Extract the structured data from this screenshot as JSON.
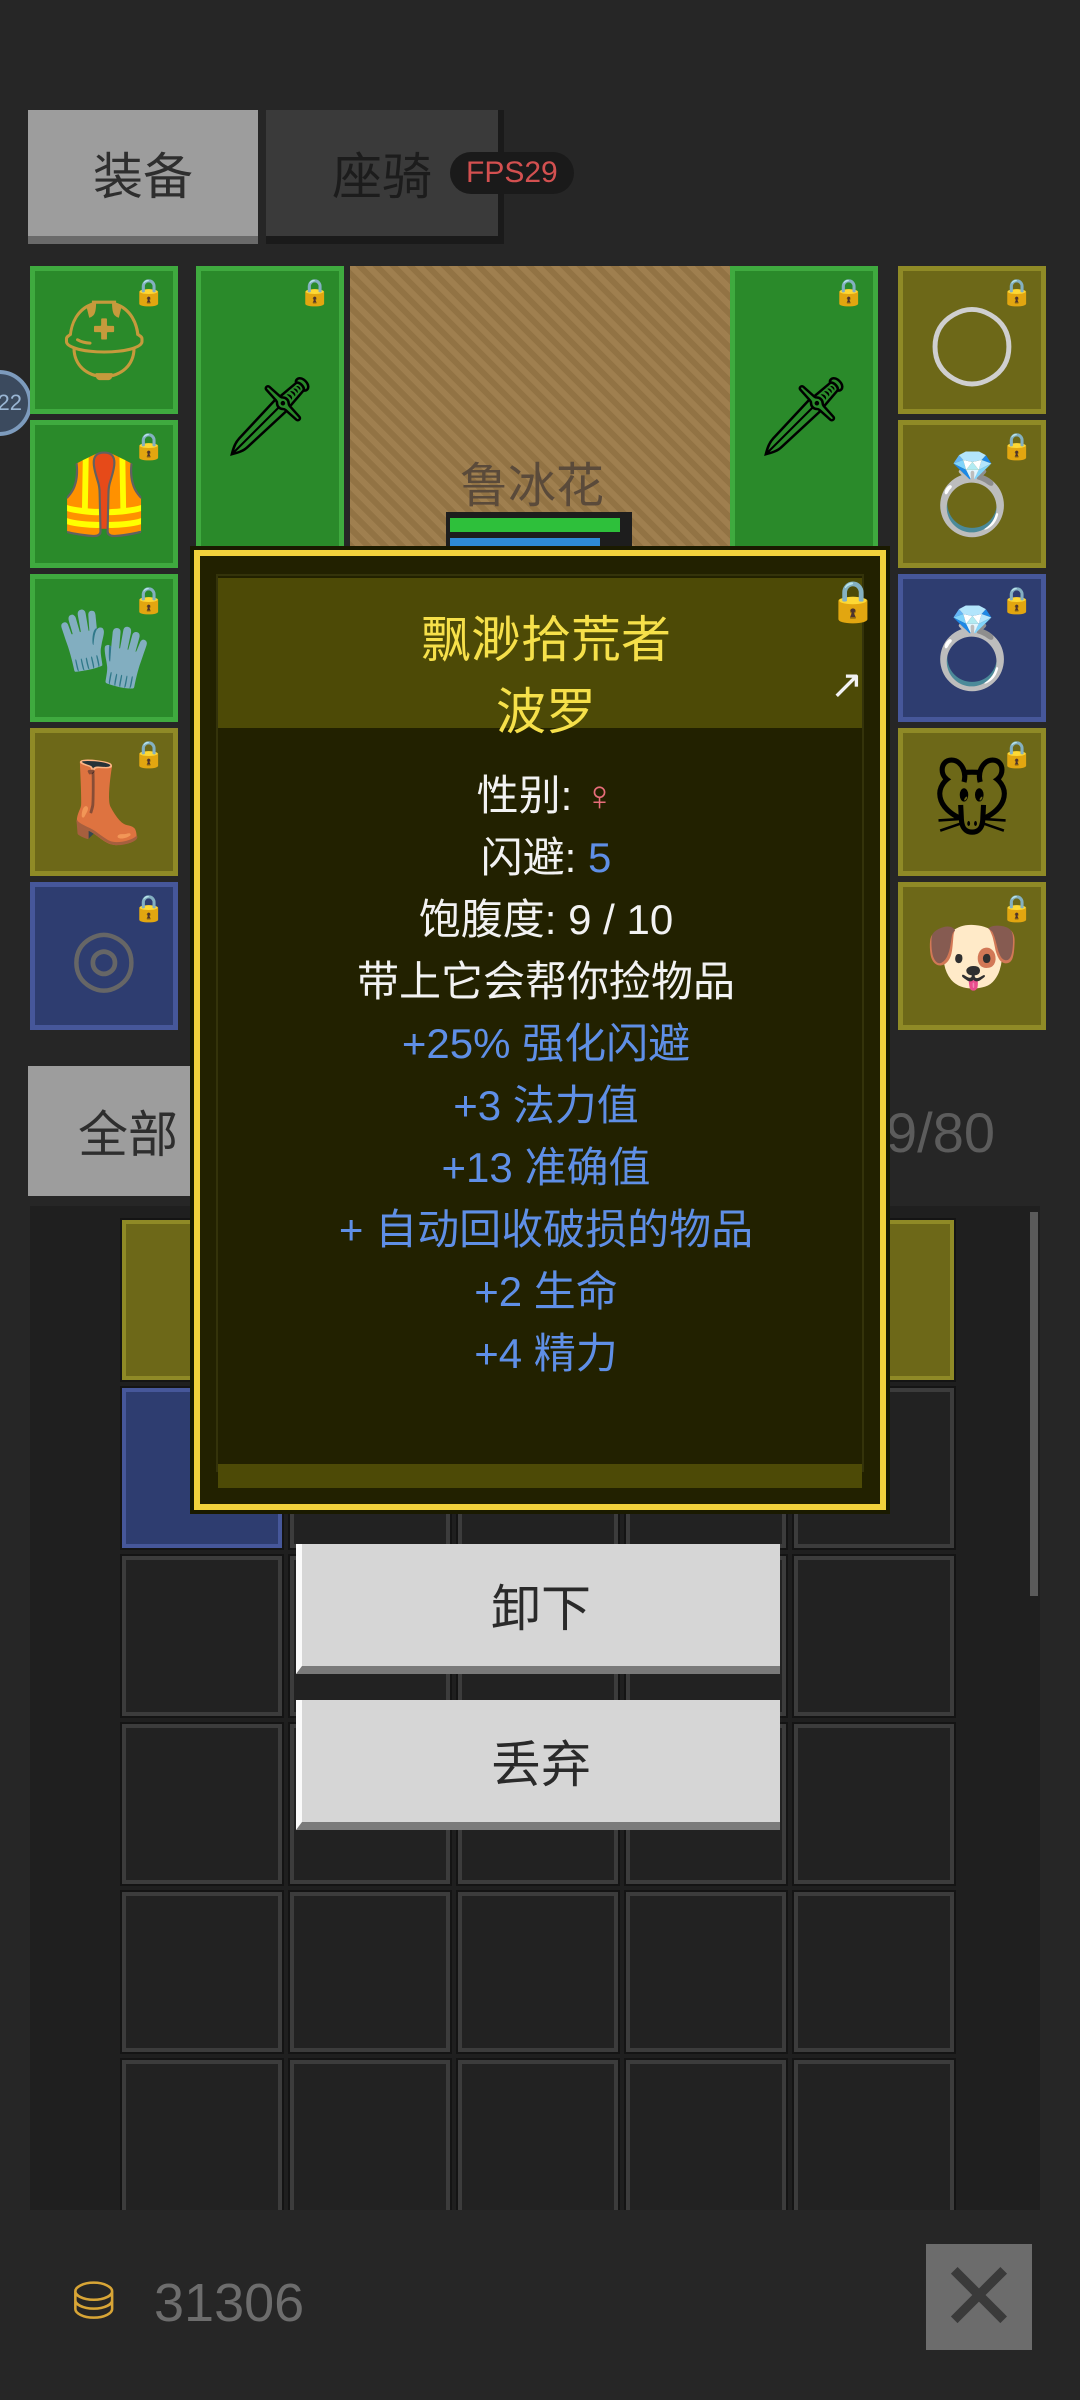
{
  "tabs": {
    "equipment": "装备",
    "mount": "座骑"
  },
  "fps_badge": "FPS29",
  "edge_badge": "22",
  "scene": {
    "character_name": "鲁冰花"
  },
  "equipment": {
    "left_column": [
      {
        "icon": "helmet-icon",
        "glyph": "⛑",
        "color": "#c69a3c"
      },
      {
        "icon": "chest-armor-icon",
        "glyph": "🦺",
        "color": "#8b4a1c"
      },
      {
        "icon": "gloves-icon",
        "glyph": "🧤",
        "color": "#3d3a5e"
      },
      {
        "icon": "boots-icon",
        "glyph": "👢",
        "color": "#5b3a1c"
      },
      {
        "icon": "belt-icon",
        "glyph": "◎",
        "color": "#3a3a3a"
      }
    ],
    "weapon_left": {
      "icon": "sword-icon",
      "glyph": "🗡"
    },
    "weapon_right": {
      "icon": "sword-icon",
      "glyph": "🗡"
    },
    "right_column": [
      {
        "icon": "amulet-icon",
        "glyph": "◯",
        "color": "#cfcfcf"
      },
      {
        "icon": "sapphire-ring-icon",
        "glyph": "💍",
        "color": "#2e6ad6"
      },
      {
        "icon": "amethyst-ring-icon",
        "glyph": "💍",
        "color": "#9a2ea8"
      },
      {
        "icon": "pet-portrait-icon",
        "glyph": "🐭",
        "color": "#ddd"
      },
      {
        "icon": "pet-dog-icon",
        "glyph": "🐶",
        "color": "#e2a35c"
      }
    ]
  },
  "filter": {
    "all_label": "全部",
    "bag_count": "9/80"
  },
  "inventory": {
    "rows": [
      [
        "yellow",
        "",
        "",
        "",
        "yellow"
      ],
      [
        "blue",
        "",
        "",
        "",
        ""
      ],
      [
        "",
        "",
        "",
        "",
        ""
      ],
      [
        "",
        "",
        "",
        "",
        ""
      ],
      [
        "",
        "",
        "",
        "",
        ""
      ],
      [
        "",
        "",
        "",
        "",
        ""
      ]
    ]
  },
  "gold": {
    "icon": "gold-coins-icon",
    "amount": "31306"
  },
  "popup": {
    "title": "飘渺拾荒者",
    "subtitle": "波罗",
    "gender_label": "性别: ",
    "gender_value": "♀",
    "evasion_label": "闪避: ",
    "evasion_value": "5",
    "satiety": "饱腹度: 9 / 10",
    "description": "带上它会帮你捡物品",
    "bonuses": [
      "+25% 强化闪避",
      "+3 法力值",
      "+13 准确值",
      "+ 自动回收破损的物品",
      "+2 生命",
      "+4 精力"
    ]
  },
  "actions": {
    "unequip": "卸下",
    "discard": "丢弃"
  }
}
